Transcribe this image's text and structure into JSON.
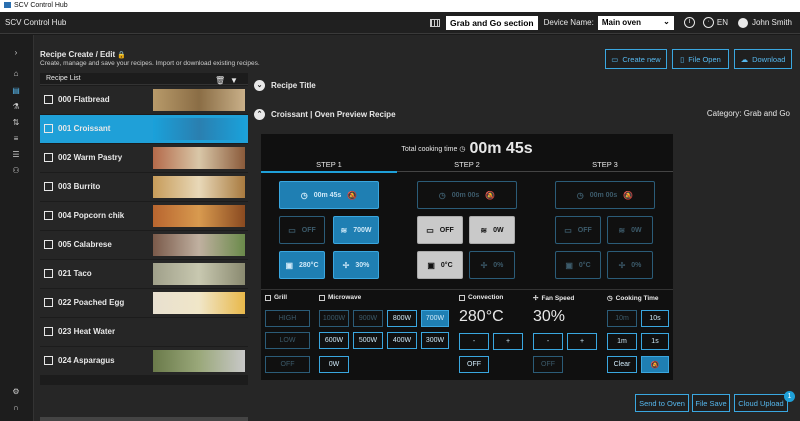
{
  "app": {
    "window_title": "SCV Control Hub",
    "hub_label": "SCV Control Hub"
  },
  "topbar": {
    "section": "Grab and Go section",
    "device_label": "Device Name:",
    "device_value": "Main oven",
    "language": "EN",
    "user": "John Smith"
  },
  "header": {
    "title": "Recipe Create / Edit",
    "subtitle": "Create, manage and save your recipes. Import or download existing recipes.",
    "buttons": {
      "create": "Create new",
      "open": "File Open",
      "download": "Download"
    }
  },
  "recipe_list": {
    "title": "Recipe List",
    "items": [
      {
        "label": "000 Flatbread",
        "selected": false
      },
      {
        "label": "001 Croissant",
        "selected": true
      },
      {
        "label": "002 Warm Pastry",
        "selected": false
      },
      {
        "label": "003 Burrito",
        "selected": false
      },
      {
        "label": "004 Popcorn chik",
        "selected": false
      },
      {
        "label": "005 Calabrese",
        "selected": false
      },
      {
        "label": "021 Taco",
        "selected": false
      },
      {
        "label": "022 Poached Egg",
        "selected": false
      },
      {
        "label": "023 Heat Water",
        "selected": false
      },
      {
        "label": "024 Asparagus",
        "selected": false
      }
    ]
  },
  "sections": {
    "recipe_title": "Recipe Title",
    "preview": "Croissant | Oven Preview Recipe",
    "category": "Category: Grab and Go"
  },
  "preview": {
    "total_label": "Total cooking time",
    "total_value": "00m 45s",
    "steps": [
      {
        "label": "STEP 1",
        "time": "00m 45s",
        "fan": "OFF",
        "microwave": "700W",
        "temp": "280°C",
        "fan_speed": "30%"
      },
      {
        "label": "STEP 2",
        "time": "00m 00s",
        "fan": "OFF",
        "microwave": "0W",
        "temp": "0°C",
        "fan_speed": "0%"
      },
      {
        "label": "STEP 3",
        "time": "00m 00s",
        "fan": "OFF",
        "microwave": "0W",
        "temp": "0°C",
        "fan_speed": "0%"
      }
    ]
  },
  "controls": {
    "grill": {
      "label": "Grill",
      "buttons": [
        "HIGH",
        "LOW",
        "OFF"
      ]
    },
    "microwave": {
      "label": "Microwave",
      "buttons": [
        "1000W",
        "900W",
        "800W",
        "700W",
        "600W",
        "500W",
        "400W",
        "300W",
        "0W"
      ],
      "selected": "700W"
    },
    "convection": {
      "label": "Convection",
      "value": "280°C",
      "minus": "-",
      "plus": "+",
      "off": "OFF"
    },
    "fan_speed": {
      "label": "Fan Speed",
      "value": "30%",
      "minus": "-",
      "plus": "+",
      "off": "OFF"
    },
    "cooking_time": {
      "label": "Cooking Time",
      "buttons": [
        "10m",
        "10s",
        "1m",
        "1s",
        "Clear"
      ]
    }
  },
  "bottom": {
    "send": "Send to Oven",
    "save": "File Save",
    "cloud": "Cloud Upload",
    "cloud_badge": "1"
  }
}
